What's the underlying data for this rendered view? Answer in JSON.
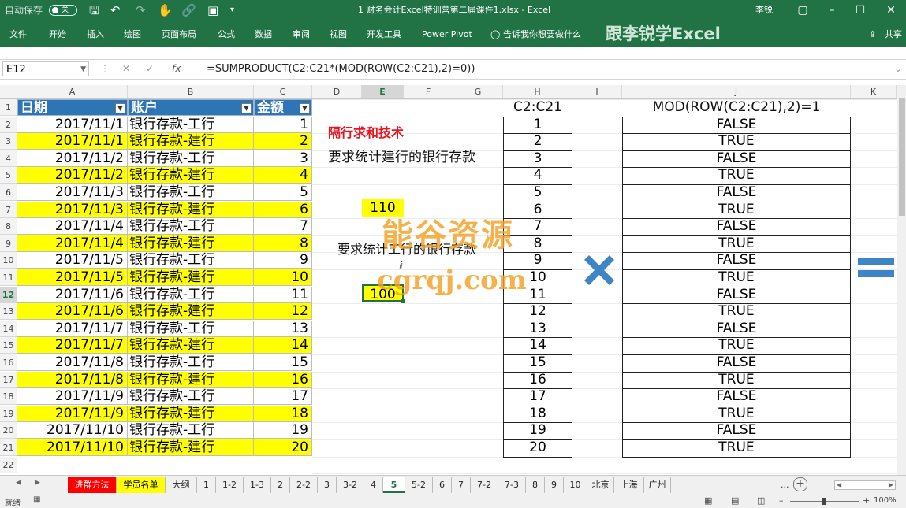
{
  "titlebar": {
    "autosave": "自动保存",
    "toggle": "关",
    "file_title": "1 财务会计Excel特训营第二届课件1.xlsx - Excel",
    "user": "李锐"
  },
  "ribbon": {
    "tabs": [
      "文件",
      "开始",
      "插入",
      "绘图",
      "页面布局",
      "公式",
      "数据",
      "审阅",
      "视图",
      "开发工具",
      "Power Pivot"
    ],
    "tell_me": "告诉我你想要做什么",
    "brand": "跟李锐学Excel",
    "share": "共享"
  },
  "formula_bar": {
    "name_box": "E12",
    "formula": "=SUMPRODUCT(C2:C21*(MOD(ROW(C2:C21),2)=0))"
  },
  "columns": [
    "A",
    "B",
    "C",
    "D",
    "E",
    "F",
    "G",
    "H",
    "I",
    "J",
    "K"
  ],
  "rows": [
    "1",
    "2",
    "3",
    "4",
    "5",
    "6",
    "7",
    "8",
    "9",
    "10",
    "11",
    "12",
    "13",
    "14",
    "15",
    "16",
    "17",
    "18",
    "19",
    "20",
    "21",
    "22"
  ],
  "table": {
    "headers": [
      "日期",
      "账户",
      "金额"
    ],
    "rows": [
      [
        "2017/11/1",
        "银行存款-工行",
        "1"
      ],
      [
        "2017/11/1",
        "银行存款-建行",
        "2"
      ],
      [
        "2017/11/2",
        "银行存款-工行",
        "3"
      ],
      [
        "2017/11/2",
        "银行存款-建行",
        "4"
      ],
      [
        "2017/11/3",
        "银行存款-工行",
        "5"
      ],
      [
        "2017/11/3",
        "银行存款-建行",
        "6"
      ],
      [
        "2017/11/4",
        "银行存款-工行",
        "7"
      ],
      [
        "2017/11/4",
        "银行存款-建行",
        "8"
      ],
      [
        "2017/11/5",
        "银行存款-工行",
        "9"
      ],
      [
        "2017/11/5",
        "银行存款-建行",
        "10"
      ],
      [
        "2017/11/6",
        "银行存款-工行",
        "11"
      ],
      [
        "2017/11/6",
        "银行存款-建行",
        "12"
      ],
      [
        "2017/11/7",
        "银行存款-工行",
        "13"
      ],
      [
        "2017/11/7",
        "银行存款-建行",
        "14"
      ],
      [
        "2017/11/8",
        "银行存款-工行",
        "15"
      ],
      [
        "2017/11/8",
        "银行存款-建行",
        "16"
      ],
      [
        "2017/11/9",
        "银行存款-工行",
        "17"
      ],
      [
        "2017/11/9",
        "银行存款-建行",
        "18"
      ],
      [
        "2017/11/10",
        "银行存款-工行",
        "19"
      ],
      [
        "2017/11/10",
        "银行存款-建行",
        "20"
      ]
    ]
  },
  "notes": {
    "title": "隔行求和技术",
    "req1": "要求统计建行的银行存款",
    "result1": "110",
    "req2": "要求统计工行的银行存款",
    "result2": "100"
  },
  "col_h": {
    "header": "C2:C21",
    "values": [
      "1",
      "2",
      "3",
      "4",
      "5",
      "6",
      "7",
      "8",
      "9",
      "10",
      "11",
      "12",
      "13",
      "14",
      "15",
      "16",
      "17",
      "18",
      "19",
      "20"
    ]
  },
  "col_j": {
    "header": "MOD(ROW(C2:C21),2)=1",
    "values": [
      "FALSE",
      "TRUE",
      "FALSE",
      "TRUE",
      "FALSE",
      "TRUE",
      "FALSE",
      "TRUE",
      "FALSE",
      "TRUE",
      "FALSE",
      "TRUE",
      "FALSE",
      "TRUE",
      "FALSE",
      "TRUE",
      "FALSE",
      "TRUE",
      "FALSE",
      "TRUE"
    ]
  },
  "watermark": {
    "line1": "能谷资源",
    "line2": "cgrqj.com"
  },
  "sheet_tabs": [
    "进群方法",
    "学员名单",
    "大纲",
    "1",
    "1-2",
    "1-3",
    "2",
    "2-2",
    "3",
    "3-2",
    "4",
    "5",
    "5-2",
    "6",
    "7",
    "7-2",
    "7-3",
    "8",
    "9",
    "10",
    "北京",
    "上海",
    "广州"
  ],
  "sheet_tab_ellipsis": "...",
  "status": {
    "ready": "就绪",
    "zoom": "100%"
  },
  "colors": {
    "excel_green": "#217346",
    "header_blue": "#2e75b6",
    "highlight_yellow": "#ffff00",
    "note_red": "#e8141e",
    "op_blue": "#3d85c6"
  }
}
